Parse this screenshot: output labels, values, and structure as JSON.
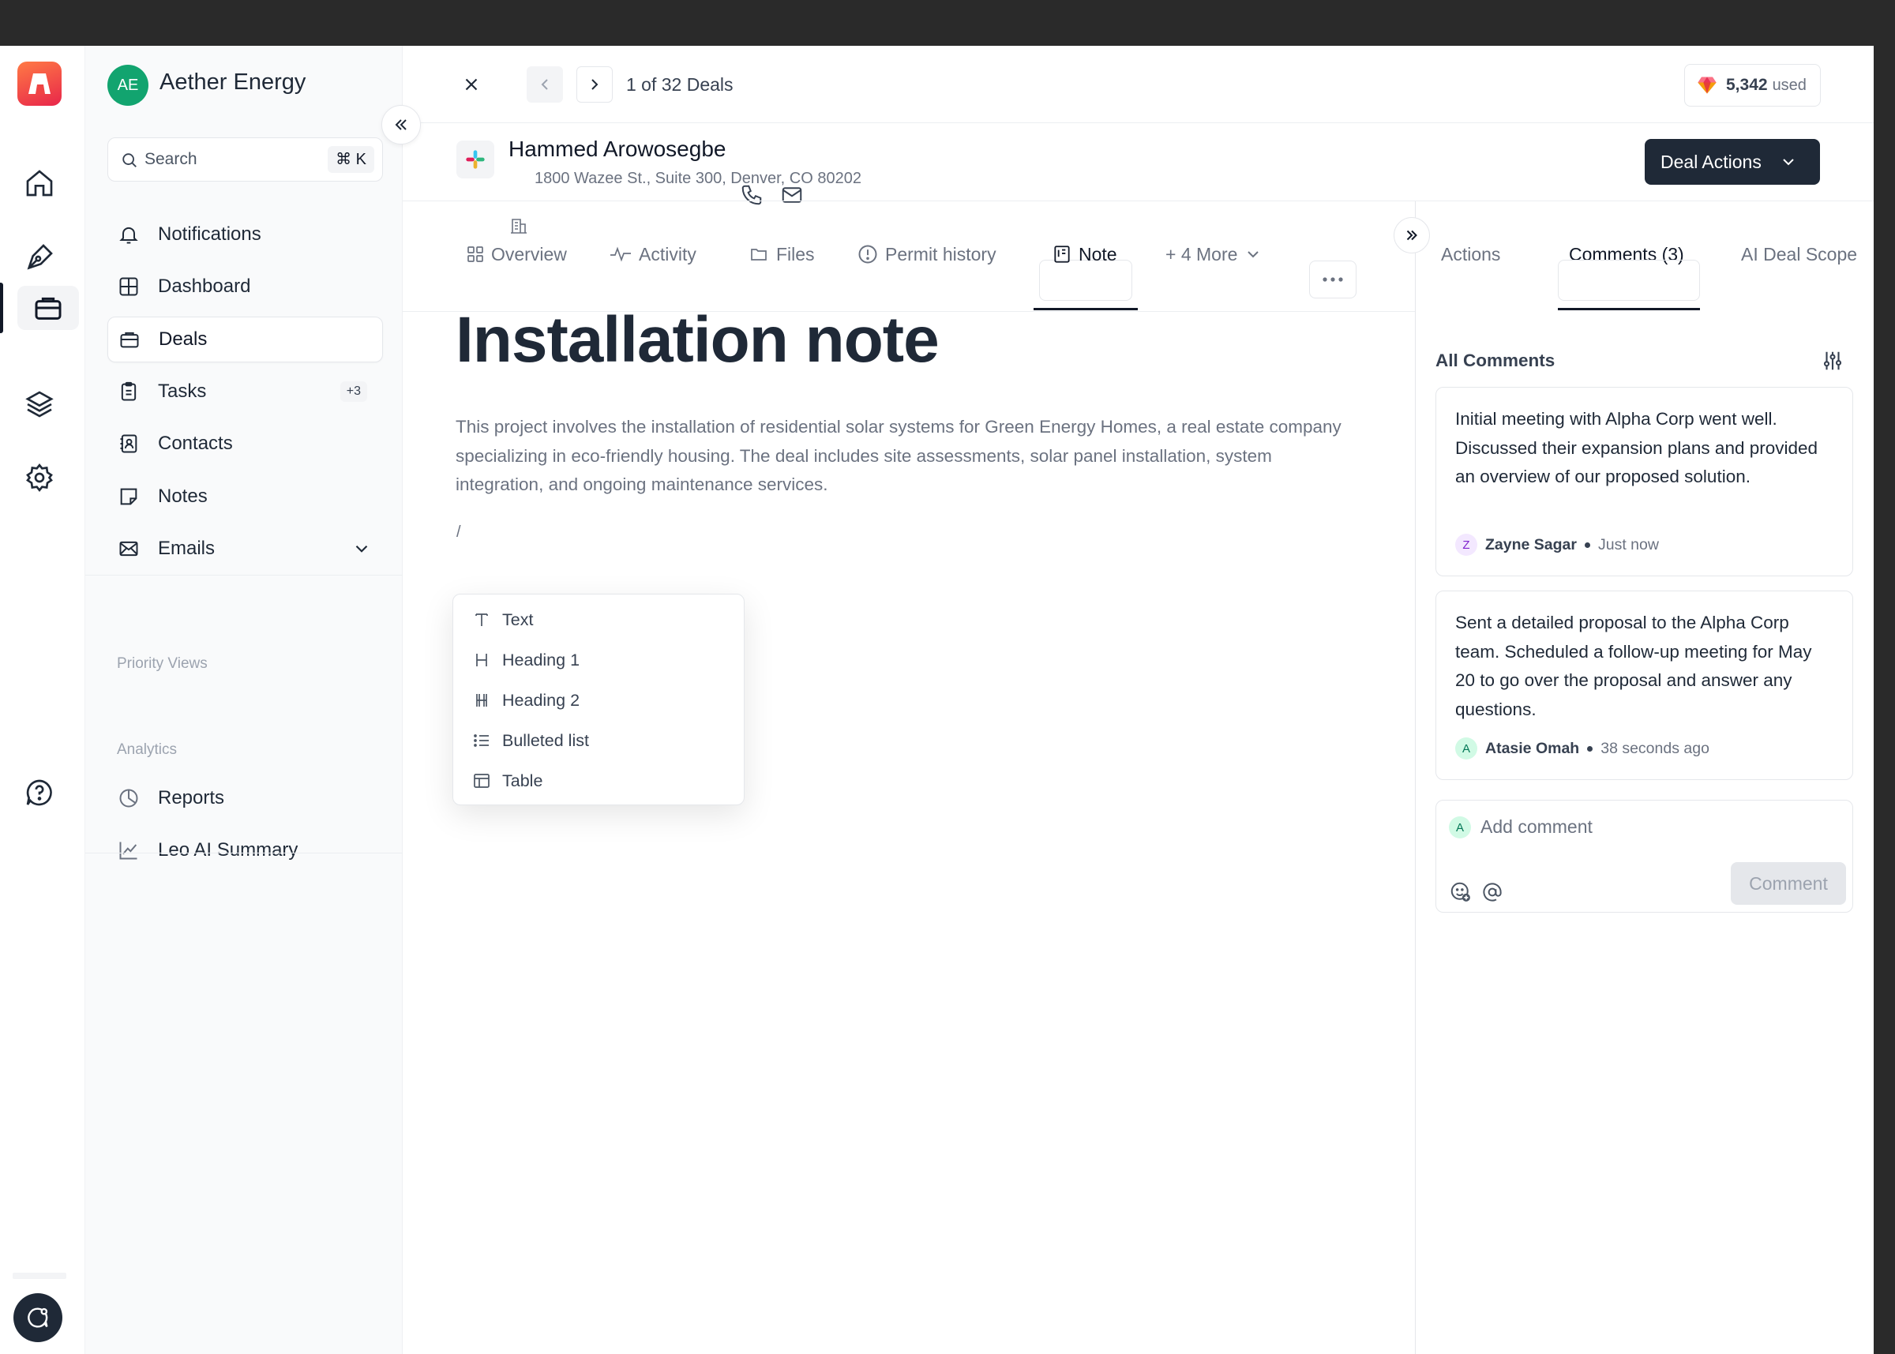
{
  "workspace": {
    "initials": "AE",
    "name": "Aether Energy"
  },
  "rail": {
    "items": [
      {
        "name": "home-icon"
      },
      {
        "name": "pen-tool-icon"
      },
      {
        "name": "briefcase-icon",
        "active": true
      },
      {
        "name": "layers-icon"
      },
      {
        "name": "gear-icon"
      },
      {
        "name": "help-chat-icon"
      },
      {
        "name": "support-chat-icon"
      }
    ]
  },
  "sidebar": {
    "search_placeholder": "Search",
    "search_shortcut": "⌘ K",
    "items": [
      {
        "label": "Notifications",
        "icon": "bell-icon"
      },
      {
        "label": "Dashboard",
        "icon": "grid-icon"
      },
      {
        "label": "Deals",
        "icon": "briefcase-icon",
        "active": true
      },
      {
        "label": "Tasks",
        "icon": "clipboard-icon",
        "badge": "+3"
      },
      {
        "label": "Contacts",
        "icon": "contact-book-icon"
      },
      {
        "label": "Notes",
        "icon": "note-icon"
      },
      {
        "label": "Emails",
        "icon": "mail-icon"
      }
    ],
    "priority_views_label": "Priority Views",
    "analytics_label": "Analytics",
    "analytics_items": [
      {
        "label": "Reports",
        "icon": "pie-chart-icon"
      },
      {
        "label": "Leo AI Summary",
        "icon": "trend-line-icon"
      }
    ]
  },
  "topbar": {
    "deals_counter": "1 of 32 Deals",
    "credits_value": "5,342",
    "credits_suffix": "used"
  },
  "contact": {
    "name": "Hammed Arowosegbe",
    "address": "1800 Wazee St., Suite 300, Denver, CO 80202",
    "deal_actions_label": "Deal Actions"
  },
  "tabs": [
    {
      "label": "Overview",
      "icon": "grid-icon"
    },
    {
      "label": "Activity",
      "icon": "activity-icon"
    },
    {
      "label": "Files",
      "icon": "folder-icon"
    },
    {
      "label": "Permit history",
      "icon": "alert-circle-icon"
    },
    {
      "label": "Note",
      "icon": "note-doc-icon",
      "active": true
    },
    {
      "label": "+ 4 More",
      "icon": "chevron-down-icon"
    }
  ],
  "right_tabs": [
    {
      "label": "Actions"
    },
    {
      "label": "Comments (3)",
      "active": true
    },
    {
      "label": "AI Deal Scope"
    }
  ],
  "note": {
    "title": "Installation note",
    "body": "This project involves the installation of residential solar systems for Green Energy Homes, a real estate company specializing in eco-friendly housing. The deal includes site assessments, solar panel installation, system integration, and ongoing maintenance services.",
    "slash": "/",
    "slash_menu": [
      {
        "label": "Text",
        "icon": "text-icon"
      },
      {
        "label": "Heading 1",
        "icon": "heading1-icon"
      },
      {
        "label": "Heading 2",
        "icon": "heading2-icon"
      },
      {
        "label": "Bulleted list",
        "icon": "list-icon"
      },
      {
        "label": "Table",
        "icon": "table-icon"
      }
    ]
  },
  "comments": {
    "header": "All Comments",
    "items": [
      {
        "text": "Initial meeting with Alpha Corp went well. Discussed their expansion plans and provided an overview of our proposed solution.",
        "author_initial": "Z",
        "author": "Zayne Sagar",
        "time": "Just now",
        "avatar_bg": "#f3e8ff",
        "avatar_fg": "#7e22ce"
      },
      {
        "text": "Sent a detailed proposal to the Alpha Corp team. Scheduled a follow-up meeting for May 20 to go over the proposal and answer any questions.",
        "author_initial": "A",
        "author": "Atasie Omah",
        "time": "38 seconds ago",
        "avatar_bg": "#d1fae5",
        "avatar_fg": "#047857"
      }
    ],
    "input_initial": "A",
    "input_placeholder": "Add comment",
    "submit_label": "Comment"
  }
}
